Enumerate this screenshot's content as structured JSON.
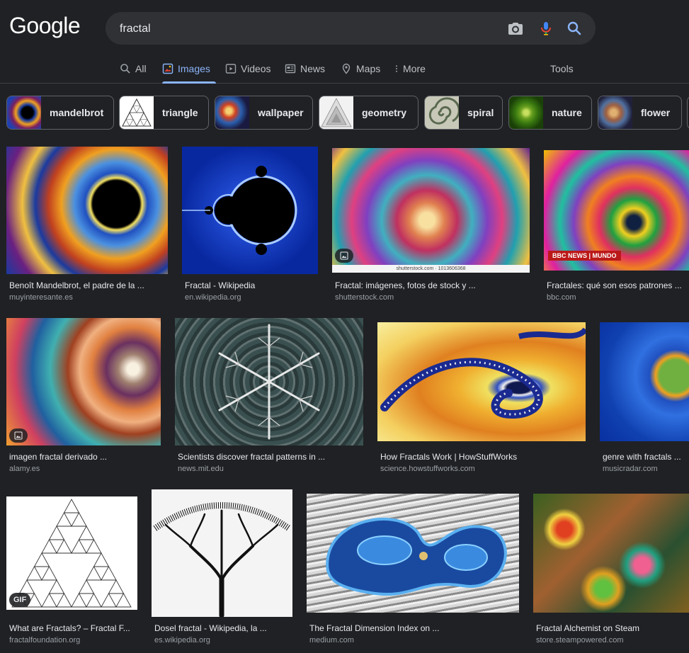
{
  "logo": "Google",
  "search": {
    "value": "fractal"
  },
  "tabs": [
    {
      "label": "All",
      "icon": "search-icon"
    },
    {
      "label": "Images",
      "icon": "images-icon"
    },
    {
      "label": "Videos",
      "icon": "play-icon"
    },
    {
      "label": "News",
      "icon": "news-icon"
    },
    {
      "label": "Maps",
      "icon": "map-pin-icon"
    },
    {
      "label": "More",
      "icon": "dots-vertical-icon"
    }
  ],
  "tools": "Tools",
  "chips": [
    {
      "label": "mandelbrot"
    },
    {
      "label": "triangle"
    },
    {
      "label": "wallpaper"
    },
    {
      "label": "geometry"
    },
    {
      "label": "spiral"
    },
    {
      "label": "nature"
    },
    {
      "label": "flower"
    }
  ],
  "results": [
    {
      "title": "Benoît Mandelbrot, el padre de la ...",
      "source": "muyinteresante.es"
    },
    {
      "title": "Fractal - Wikipedia",
      "source": "en.wikipedia.org"
    },
    {
      "title": "Fractal: imágenes, fotos de stock y ...",
      "source": "shutterstock.com",
      "watermark": "shutterstock.com · 1013606368"
    },
    {
      "title": "Fractales: qué son esos patrones ...",
      "source": "bbc.com",
      "logo": "BBC NEWS | MUNDO"
    },
    {
      "title": "imagen fractal derivado ...",
      "source": "alamy.es"
    },
    {
      "title": "Scientists discover fractal patterns in ...",
      "source": "news.mit.edu"
    },
    {
      "title": "How Fractals Work | HowStuffWorks",
      "source": "science.howstuffworks.com"
    },
    {
      "title": "genre with fractals ...",
      "source": "musicradar.com"
    },
    {
      "title": "What are Fractals? – Fractal F...",
      "source": "fractalfoundation.org",
      "badge": "GIF"
    },
    {
      "title": "Dosel fractal - Wikipedia, la ...",
      "source": "es.wikipedia.org"
    },
    {
      "title": "The Fractal Dimension Index on ...",
      "source": "medium.com"
    },
    {
      "title": "Fractal Alchemist on Steam",
      "source": "store.steampowered.com"
    }
  ],
  "colors": {
    "accent": "#8ab4f8",
    "background": "#202124",
    "search_bg": "#303134"
  }
}
